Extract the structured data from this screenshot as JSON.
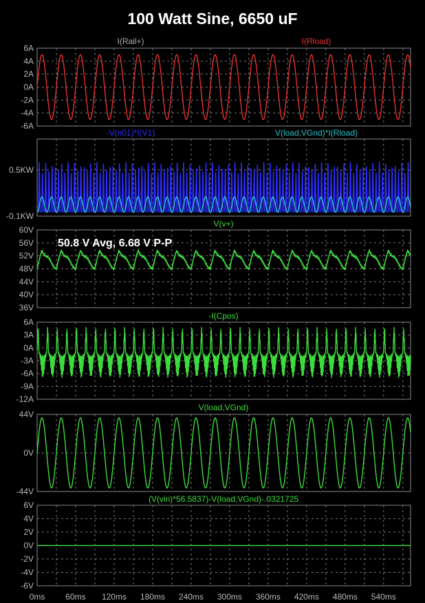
{
  "title": "100 Watt Sine, 6650 uF",
  "colors": {
    "red": "#e83030",
    "blue": "#2d2dff",
    "cyan": "#27c2c8",
    "green": "#3ddc3d",
    "gray": "#b0b0b0",
    "grid": "#7a7a7a"
  },
  "chart_data": [
    {
      "type": "line",
      "title": "",
      "ylim": [
        -6,
        6
      ],
      "yticks": [
        "6A",
        "4A",
        "2A",
        "0A",
        "-2A",
        "-4A",
        "-6A"
      ],
      "series": [
        {
          "name": "I(Rail+)",
          "color": "gray",
          "label_position": "left",
          "waveform": "none"
        },
        {
          "name": "I(Rload)",
          "color": "red",
          "label_position": "right",
          "waveform": "sine",
          "amplitude": 5,
          "offset": 0,
          "period_ms": 30
        }
      ]
    },
    {
      "type": "line",
      "title": "",
      "ylim": [
        -0.1,
        0.9
      ],
      "yticks": [
        "0.5KW",
        "-0.1KW"
      ],
      "series": [
        {
          "name": "-V(n01)*I(V1)",
          "color": "blue",
          "label_position": "left",
          "waveform": "spikes",
          "base": -0.05,
          "peak": 0.6,
          "period_ms": 5
        },
        {
          "name": "V(load,VGnd)*I(Rload)",
          "color": "cyan",
          "label_position": "right",
          "waveform": "power",
          "amplitude": 0.2,
          "offset": -0.05,
          "period_ms": 15
        }
      ]
    },
    {
      "type": "line",
      "title": "",
      "ylim": [
        36,
        60
      ],
      "yticks": [
        "60V",
        "56V",
        "52V",
        "48V",
        "44V",
        "40V",
        "36V"
      ],
      "annotation": "50.8 V Avg, 6.68 V P-P",
      "series": [
        {
          "name": "V(v+)",
          "color": "green",
          "label_position": "center",
          "waveform": "ripple",
          "mean": 50.8,
          "pp": 6.68,
          "period_ms": 30
        }
      ]
    },
    {
      "type": "line",
      "title": "",
      "ylim": [
        -12,
        6
      ],
      "yticks": [
        "6A",
        "3A",
        "0A",
        "-3A",
        "-6A",
        "-9A",
        "-12A"
      ],
      "series": [
        {
          "name": "-I(Cpos)",
          "color": "green",
          "label_position": "center",
          "waveform": "cap",
          "max": 5,
          "min": -7,
          "period_ms": 15
        }
      ]
    },
    {
      "type": "line",
      "title": "",
      "ylim": [
        -44,
        44
      ],
      "yticks": [
        "44V",
        "0V",
        "-44V"
      ],
      "series": [
        {
          "name": "V(load,VGnd)",
          "color": "green",
          "label_position": "center",
          "waveform": "sine",
          "amplitude": 40,
          "offset": 0,
          "period_ms": 30
        }
      ]
    },
    {
      "type": "line",
      "title": "",
      "ylim": [
        -6,
        6
      ],
      "yticks": [
        "6V",
        "4V",
        "2V",
        "0V",
        "-2V",
        "-4V",
        "-6V"
      ],
      "series": [
        {
          "name": "(V(vin)*56.5837)-V(load,VGnd)-.0321725",
          "color": "green",
          "label_position": "center",
          "waveform": "flat",
          "value": 0
        }
      ]
    }
  ],
  "x_axis": {
    "xlim": [
      0,
      582
    ],
    "ticks": [
      0,
      60,
      120,
      180,
      240,
      300,
      360,
      420,
      480,
      540
    ],
    "tick_labels": [
      "0ms",
      "60ms",
      "120ms",
      "180ms",
      "240ms",
      "300ms",
      "360ms",
      "420ms",
      "480ms",
      "540ms"
    ],
    "grid_step_ms": 30
  }
}
